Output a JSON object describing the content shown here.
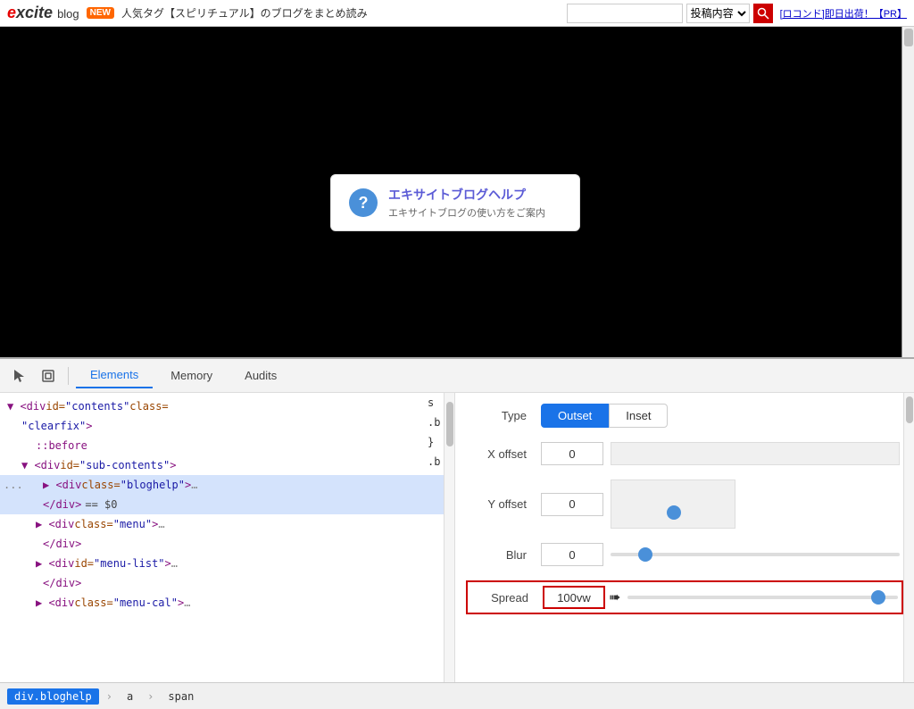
{
  "topbar": {
    "logo": "excite",
    "logo_suffix": "blog",
    "new_badge": "NEW",
    "promo_text": "人気タグ【スピリチュアル】のブログをまとめ読み",
    "search_placeholder": "",
    "search_select_options": [
      "投稿内容"
    ],
    "search_select_value": "投稿内容",
    "ad_text": "[ロコンド]即日出荷！【PR】"
  },
  "browser": {
    "help_popup": {
      "title": "エキサイトブログヘルプ",
      "subtitle": "エキサイトブログの使い方をご案内"
    }
  },
  "devtools": {
    "tabs": [
      "Elements",
      "Memory",
      "Audits"
    ],
    "active_tab": "Elements",
    "icons": [
      "cursor-icon",
      "box-icon"
    ]
  },
  "elements_tree": [
    {
      "indent": 0,
      "text": "▼ <div id=\"contents\" class=",
      "parts": [
        "tag",
        "attr"
      ],
      "dots": false
    },
    {
      "indent": 1,
      "text": "\"clearfix\">",
      "parts": [
        "attr_val"
      ],
      "dots": false
    },
    {
      "indent": 2,
      "text": "::before",
      "parts": [
        "pseudo"
      ],
      "dots": false
    },
    {
      "indent": 1,
      "text": "▼ <div id=\"sub-contents\">",
      "parts": [
        "tag"
      ],
      "dots": false
    },
    {
      "indent": 3,
      "text": "▶ <div class=\"bloghelp\">…",
      "parts": [
        "tag"
      ],
      "dots": true,
      "selected": true
    },
    {
      "indent": 3,
      "text": "</div> == $0",
      "parts": [
        "tag",
        "special"
      ],
      "dots": false,
      "selected": true
    },
    {
      "indent": 3,
      "text": "▶ <div class=\"menu\">…",
      "parts": [
        "tag"
      ],
      "dots": false
    },
    {
      "indent": 3,
      "text": "</div>",
      "parts": [
        "tag"
      ],
      "dots": false
    },
    {
      "indent": 3,
      "text": "▶ <div id=\"menu-list\">…",
      "parts": [
        "tag"
      ],
      "dots": false
    },
    {
      "indent": 3,
      "text": "</div>",
      "parts": [
        "tag"
      ],
      "dots": false
    },
    {
      "indent": 3,
      "text": "▶ <div class=\"menu-cal\">…",
      "parts": [
        "tag"
      ],
      "dots": false
    }
  ],
  "shadow_editor": {
    "type_buttons": [
      "Outset",
      "Inset"
    ],
    "active_type": "Outset",
    "fields": [
      {
        "label": "Type",
        "type": "buttons"
      },
      {
        "label": "X offset",
        "value": "0",
        "has_slider": false
      },
      {
        "label": "Y offset",
        "value": "0",
        "has_2d_slider": true
      },
      {
        "label": "Blur",
        "value": "0",
        "has_h_slider": true,
        "slider_val": 10
      },
      {
        "label": "Spread",
        "value": "100vw",
        "has_h_slider": true,
        "slider_val": 95,
        "highlighted": true
      }
    ]
  },
  "status_bar": {
    "items": [
      "div.bloghelp",
      "a",
      "span"
    ]
  },
  "colors": {
    "accent_blue": "#1a73e8",
    "devtools_selected": "#d4e3fc",
    "tag_color": "#881280",
    "attr_name_color": "#994500",
    "attr_val_color": "#1a1aa6"
  }
}
